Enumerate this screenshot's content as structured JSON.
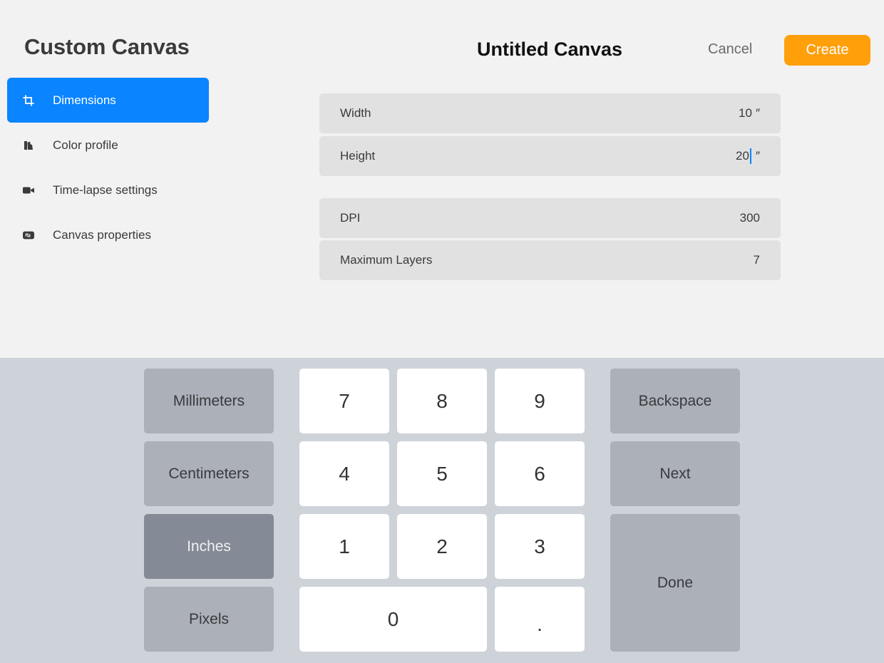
{
  "sidebar": {
    "title": "Custom Canvas",
    "items": [
      {
        "label": "Dimensions",
        "icon": "crop-icon",
        "active": true
      },
      {
        "label": "Color profile",
        "icon": "color-swatch-icon",
        "active": false
      },
      {
        "label": "Time-lapse settings",
        "icon": "video-camera-icon",
        "active": false
      },
      {
        "label": "Canvas properties",
        "icon": "canvas-properties-icon",
        "active": false
      }
    ]
  },
  "header": {
    "title": "Untitled Canvas",
    "cancel_label": "Cancel",
    "create_label": "Create"
  },
  "fields": {
    "width": {
      "label": "Width",
      "value": "10",
      "unit": "″"
    },
    "height": {
      "label": "Height",
      "value_before_caret": "20",
      "unit": "″"
    },
    "dpi": {
      "label": "DPI",
      "value": "300"
    },
    "max_layers": {
      "label": "Maximum Layers",
      "value": "7"
    }
  },
  "keypad": {
    "units": {
      "millimeters": "Millimeters",
      "centimeters": "Centimeters",
      "inches": "Inches",
      "pixels": "Pixels",
      "selected": "Inches"
    },
    "digits": {
      "k7": "7",
      "k8": "8",
      "k9": "9",
      "k4": "4",
      "k5": "5",
      "k6": "6",
      "k1": "1",
      "k2": "2",
      "k3": "3",
      "k0": "0",
      "dot": "."
    },
    "actions": {
      "backspace": "Backspace",
      "next": "Next",
      "done": "Done"
    }
  },
  "colors": {
    "accent_blue": "#0a84ff",
    "create_orange": "#ff9f0a",
    "background": "#f2f2f2",
    "keypad_background": "#ced2d9"
  }
}
